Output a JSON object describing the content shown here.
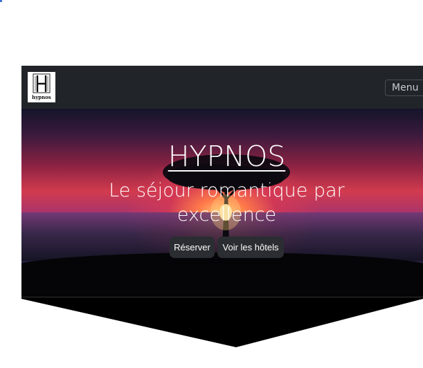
{
  "navbar": {
    "logo_text": "hypnos",
    "menu_label": "Menu"
  },
  "hero": {
    "title": "HYPNOS",
    "subtitle": "Le séjour romantique par excellence",
    "buttons": {
      "reserve": "Réserver",
      "hotels": "Voir les hôtels"
    }
  },
  "colors": {
    "navbar_bg": "#212529",
    "button_bg": "#2a2d31",
    "text": "#ffffff"
  }
}
